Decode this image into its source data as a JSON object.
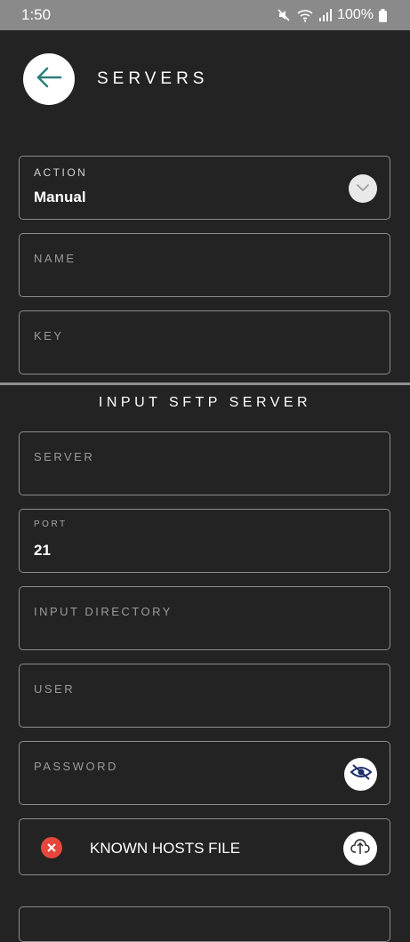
{
  "status_bar": {
    "time": "1:50",
    "battery": "100%",
    "icons": [
      "mute-icon",
      "wifi-icon",
      "signal-icon",
      "battery-icon"
    ]
  },
  "header": {
    "title": "SERVERS",
    "back_icon": "arrow-left-icon"
  },
  "form": {
    "action": {
      "label": "ACTION",
      "value": "Manual",
      "icon": "chevron-down-icon"
    },
    "name": {
      "label": "NAME",
      "value": ""
    },
    "key": {
      "label": "KEY",
      "value": ""
    }
  },
  "input_sftp": {
    "title": "INPUT SFTP SERVER",
    "server": {
      "label": "SERVER",
      "value": ""
    },
    "port": {
      "label": "PORT",
      "value": "21"
    },
    "input_directory": {
      "label": "INPUT DIRECTORY",
      "value": ""
    },
    "user": {
      "label": "USER",
      "value": ""
    },
    "password": {
      "label": "PASSWORD",
      "value": "",
      "icon": "eye-off-icon"
    },
    "known_hosts": {
      "label": "KNOWN HOSTS FILE",
      "status_icon": "error-x-icon",
      "upload_icon": "cloud-upload-icon"
    }
  },
  "colors": {
    "background": "#232323",
    "status_bar": "#8a8a8a",
    "accent": "#2f7f7a",
    "error": "#e5473b",
    "border": "#8c8c8c"
  }
}
